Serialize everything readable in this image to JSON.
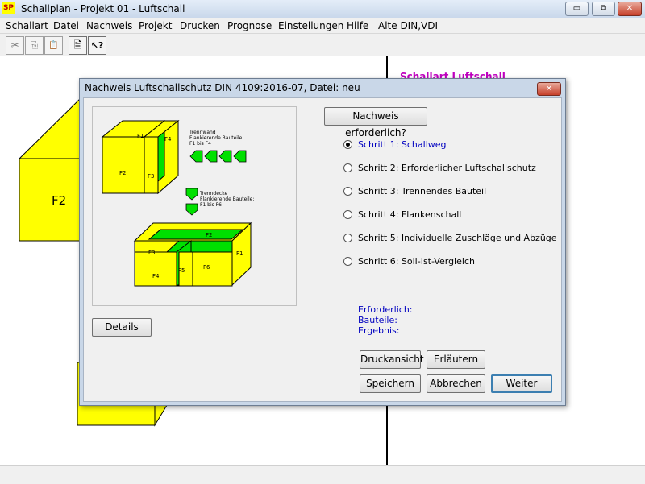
{
  "window": {
    "icon_text": "SP",
    "title": "Schallplan  - Projekt 01 - Luftschall",
    "minimize_glyph": "▭",
    "maximize_glyph": "⧉",
    "close_glyph": "✕"
  },
  "menu": [
    "Schallart",
    "Datei",
    "Nachweis",
    "Projekt",
    "Drucken",
    "Prognose",
    "Einstellungen",
    "Hilfe",
    "Alte DIN,VDI"
  ],
  "toolbar": {
    "cut_icon": "✂",
    "copy_icon": "⎘",
    "paste_icon": "📋",
    "properties_icon": "🗎",
    "help_icon": "↖?"
  },
  "workspace": {
    "heading": "Schallart Luftschall",
    "wall_label": "F2"
  },
  "dialog": {
    "title": "Nachweis Luftschallschutz DIN 4109:2016-07, Datei: neu",
    "close_glyph": "✕",
    "nachweis_button": "Nachweis erforderlich?",
    "details_button": "Details",
    "steps": [
      {
        "label": "Schritt 1: Schallweg",
        "checked": true
      },
      {
        "label": "Schritt 2: Erforderlicher Luftschallschutz",
        "checked": false
      },
      {
        "label": "Schritt 3: Trennendes Bauteil",
        "checked": false
      },
      {
        "label": "Schritt 4: Flankenschall",
        "checked": false
      },
      {
        "label": "Schritt 5: Individuelle Zuschläge und Abzüge",
        "checked": false
      },
      {
        "label": "Schritt 6: Soll-Ist-Vergleich",
        "checked": false
      }
    ],
    "results": {
      "erforderlich": "Erforderlich:",
      "bauteile": "Bauteile:",
      "ergebnis": "Ergebnis:"
    },
    "buttons": {
      "druckansicht": "Druckansicht",
      "erlaeutern": "Erläutern",
      "speichern": "Speichern",
      "abbrechen": "Abbrechen",
      "weiter": "Weiter"
    },
    "illustration": {
      "wall_text": [
        "Trennwand",
        "Flankierende Bauteile:",
        "F1 bis F4"
      ],
      "ceiling_text": [
        "Trenndecke",
        "Flankierende Bauteile:",
        "F1 bis F6"
      ],
      "top_box": {
        "f1": "F1",
        "f2": "F2",
        "f3": "F3",
        "f4": "F4"
      },
      "bottom_box": {
        "f1": "F1",
        "f2": "F2",
        "f3": "F3",
        "f4": "F4",
        "f5": "F5",
        "f6": "F6"
      }
    }
  },
  "colors": {
    "wall_yellow": "#ffff00",
    "separator_green": "#00e000",
    "selected_blue": "#0000c0",
    "heading_magenta": "#c000c0"
  }
}
